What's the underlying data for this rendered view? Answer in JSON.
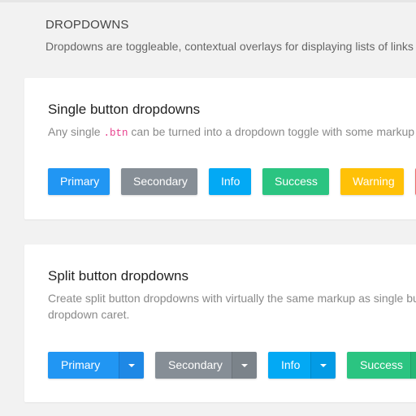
{
  "header": {
    "title": "DROPDOWNS",
    "description": "Dropdowns are toggleable, contextual overlays for displaying lists of links a"
  },
  "single": {
    "title": "Single button dropdowns",
    "desc_before": "Any single ",
    "desc_code": ".btn",
    "desc_after": " can be turned into a dropdown toggle with some markup ch",
    "buttons": [
      "Primary",
      "Secondary",
      "Info",
      "Success",
      "Warning"
    ]
  },
  "split": {
    "title": "Split button dropdowns",
    "description": "Create split button dropdowns with virtually the same markup as single butto dropdown caret.",
    "desc_line1": "Create split button dropdowns with virtually the same markup as single butt",
    "desc_line2": "dropdown caret.",
    "buttons": [
      "Primary",
      "Secondary",
      "Info",
      "Success"
    ]
  },
  "colors": {
    "primary": "#2196f3",
    "secondary": "#868e96",
    "info": "#03a9f4",
    "success": "#2bc481",
    "warning": "#ffc107",
    "danger": "#f06c6c"
  }
}
